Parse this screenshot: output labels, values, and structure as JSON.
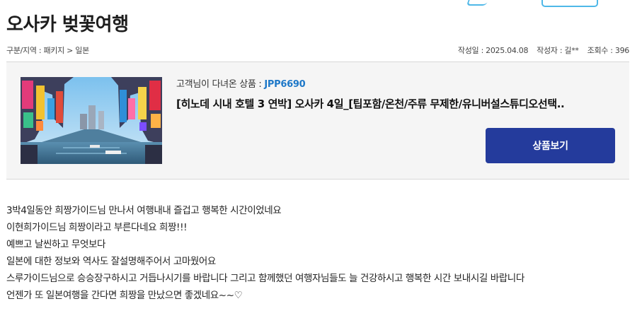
{
  "review": {
    "title": "오사카 벚꽃여행",
    "category": "구분/지역 : 패키지 > 일본",
    "date": "작성일 : 2025.04.08",
    "author": "작성자 : 길**",
    "views": "조회수 : 396"
  },
  "product": {
    "code_label": "고객님이 다녀온 상품 : ",
    "code": "JPP6690",
    "name": "[히노데 시내 호텔 3 연박] 오사카 4일_[팁포함/온천/주류 무제한/유니버설스튜디오선택..",
    "view_button": "상품보기",
    "image_icon": "osaka-dotonbori-photo"
  },
  "content": {
    "lines": [
      "3박4일동안 희짱가이드님 만나서 여행내내 즐겁고 행복한 시간이었네요",
      "이현희가이드님 희짱이라고 부른다네요 희짱!!!",
      "예쁘고 날씬하고 무엇보다",
      "일본에 대한 정보와 역사도 잘설명해주어서 고마웠어요",
      "스루가이드님으로 승승장구하시고 거듭나시기를 바랍니다 그리고 함께했던 여행자님들도 늘 건강하시고 행복한 시간 보내시길 바랍니다",
      "언젠가 또 일본여행을 간다면 희짱을 만났으면 좋겠네요~~♡"
    ]
  },
  "colors": {
    "accent": "#243b9c",
    "code": "#1e78c8",
    "box_bg": "#f5f5f5"
  }
}
